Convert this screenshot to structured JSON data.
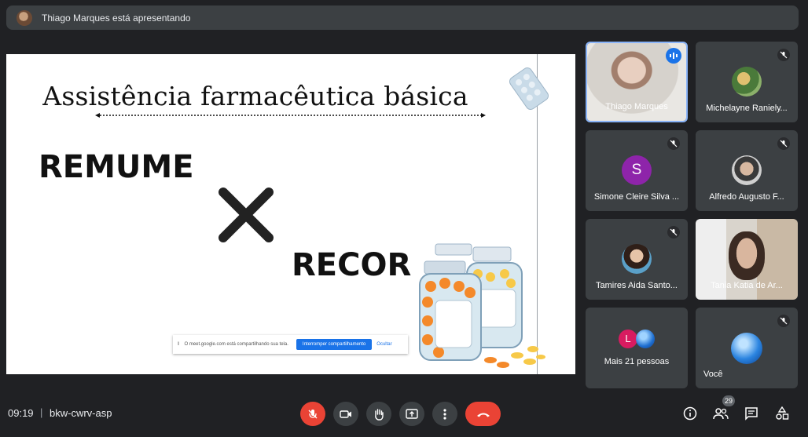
{
  "presenter_bar": {
    "text": "Thiago Marques está apresentando"
  },
  "slide": {
    "title": "Assistência farmacêutica básica",
    "word1": "REMUME",
    "word2": "RECOR",
    "share_bar": {
      "message": "O meet.google.com está compartilhando sua tela.",
      "stop_button": "Interromper compartilhamento",
      "hide_link": "Ocultar"
    }
  },
  "participants": [
    {
      "name": "Thiago Marques",
      "state": "speaking"
    },
    {
      "name": "Michelayne Ranielу...",
      "state": "muted"
    },
    {
      "name": "Simone Cleire Silva ...",
      "initial": "S",
      "color": "#8e24aa",
      "state": "muted"
    },
    {
      "name": "Alfredo Augusto F...",
      "state": "muted"
    },
    {
      "name": "Tamires Aida Santo...",
      "state": "muted"
    },
    {
      "name": "Tania Katia de Ar...",
      "state": "video"
    },
    {
      "name": "Mais 21 pessoas",
      "initial": "L",
      "color": "#d81b60"
    },
    {
      "name": "Você",
      "state": "muted"
    }
  ],
  "bottom_bar": {
    "time": "09:19",
    "separator": "|",
    "meeting_code": "bkw-cwrv-asp",
    "people_count": "29"
  },
  "colors": {
    "background": "#202124",
    "tile": "#3c4043",
    "danger": "#ea4335",
    "accent": "#1a73e8"
  }
}
